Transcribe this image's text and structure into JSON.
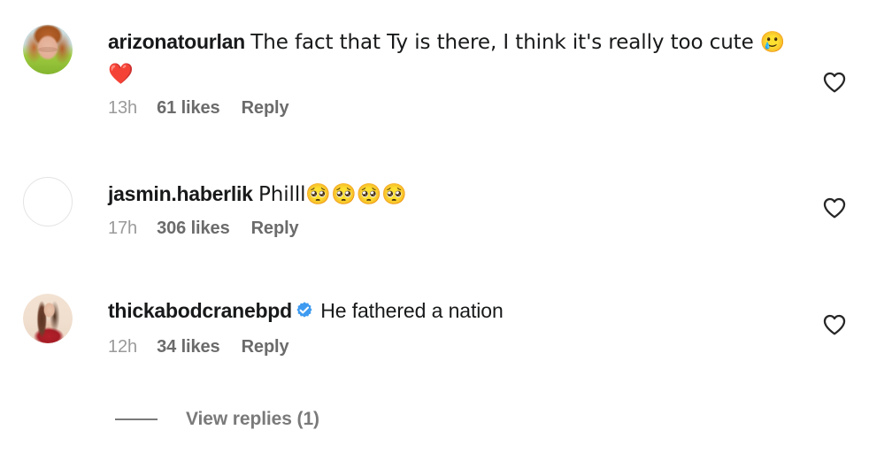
{
  "theme": {
    "background": "#ffffff",
    "text_primary": "#18191a",
    "text_secondary": "#6b6b6b",
    "text_muted": "#9a9a9a",
    "verified_blue": "#3e9bf0",
    "heart_outline": "#262626"
  },
  "comments": [
    {
      "username": "arizonatourlan",
      "verified": false,
      "text": "The fact that Ty is there, I think it's really too cute 🥲 ❤️",
      "time": "13h",
      "likes": "61 likes",
      "reply": "Reply",
      "avatar": "photo-arizonatourlan",
      "like_icon": "heart-outline-icon"
    },
    {
      "username": "jasmin.haberlik",
      "verified": false,
      "text": "Philll🥺🥺🥺🥺",
      "time": "17h",
      "likes": "306 likes",
      "reply": "Reply",
      "avatar": "placeholder-avatar",
      "like_icon": "heart-outline-icon"
    },
    {
      "username": "thickabodcranebpd",
      "verified": true,
      "text": "He fathered a nation",
      "time": "12h",
      "likes": "34 likes",
      "reply": "Reply",
      "avatar": "photo-thickabodcranebpd",
      "like_icon": "heart-outline-icon"
    }
  ],
  "view_replies": {
    "label": "View replies (1)"
  }
}
